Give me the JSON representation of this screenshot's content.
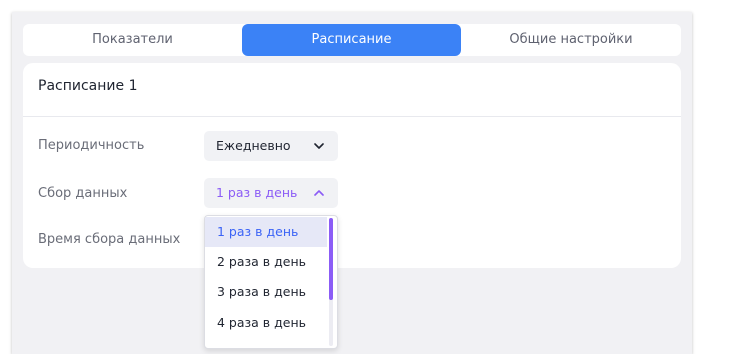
{
  "tabs": [
    {
      "label": "Показатели",
      "active": false
    },
    {
      "label": "Расписание",
      "active": true
    },
    {
      "label": "Общие настройки",
      "active": false
    }
  ],
  "card": {
    "title": "Расписание 1"
  },
  "form": {
    "periodicity": {
      "label": "Периодичность",
      "value": "Ежедневно",
      "expanded": false
    },
    "data_collection": {
      "label": "Сбор данных",
      "value": "1 раз в день",
      "expanded": true,
      "options": [
        "1 раз в день",
        "2 раза в день",
        "3 раза в день",
        "4 раза в день"
      ],
      "selected_index": 0
    },
    "collection_time": {
      "label": "Время сбора данных"
    }
  },
  "icons": {
    "periodicity_chevron": "chevron-down-icon",
    "data_collection_chevron": "chevron-up-icon"
  },
  "colors": {
    "accent_blue": "#3b82f6",
    "accent_purple": "#8b5cf6",
    "panel_bg": "#f1f1f4",
    "selected_option_bg": "#e6e8f7"
  }
}
